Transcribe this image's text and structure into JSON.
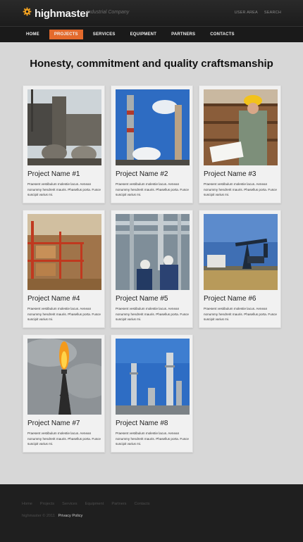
{
  "header": {
    "logo_text": "highmaster",
    "tagline": "Industrial Company",
    "top_links": [
      "USER AREA",
      "SEARCH"
    ],
    "nav": [
      "HOME",
      "PROJECTS",
      "SERVICES",
      "EQUIPMENT",
      "PARTNERS",
      "CONTACTS"
    ],
    "active_nav": "PROJECTS"
  },
  "main": {
    "heading": "Honesty, commitment and quality craftsmanship",
    "projects": [
      {
        "title": "Project Name #1",
        "desc": "Praesent vestibulum molestie lacus. Aenean nonummy hendrerit mauris. Phasellus porta. Fusce suscipit varius mi."
      },
      {
        "title": "Project Name #2",
        "desc": "Praesent vestibulum molestie lacus. Aenean nonummy hendrerit mauris. Phasellus porta. Fusce suscipit varius mi."
      },
      {
        "title": "Project Name #3",
        "desc": "Praesent vestibulum molestie lacus. Aenean nonummy hendrerit mauris. Phasellus porta. Fusce suscipit varius mi."
      },
      {
        "title": "Project Name #4",
        "desc": "Praesent vestibulum molestie lacus. Aenean nonummy hendrerit mauris. Phasellus porta. Fusce suscipit varius mi."
      },
      {
        "title": "Project Name #5",
        "desc": "Praesent vestibulum molestie lacus. Aenean nonummy hendrerit mauris. Phasellus porta. Fusce suscipit varius mi."
      },
      {
        "title": "Project Name #6",
        "desc": "Praesent vestibulum molestie lacus. Aenean nonummy hendrerit mauris. Phasellus porta. Fusce suscipit varius mi."
      },
      {
        "title": "Project Name #7",
        "desc": "Praesent vestibulum molestie lacus. Aenean nonummy hendrerit mauris. Phasellus porta. Fusce suscipit varius mi."
      },
      {
        "title": "Project Name #8",
        "desc": "Praesent vestibulum molestie lacus. Aenean nonummy hendrerit mauris. Phasellus porta. Fusce suscipit varius mi."
      }
    ]
  },
  "footer": {
    "links": [
      "Home",
      "Projects",
      "Services",
      "Equipment",
      "Partners",
      "Contacts"
    ],
    "copyright": "highmaster © 2011",
    "privacy": "Privacy Policy"
  },
  "colors": {
    "accent": "#e46a2c",
    "header_bg": "#1c1c1c",
    "page_bg": "#d7d7d7",
    "footer_bg": "#1f1f1f"
  },
  "icons": {
    "logo": "gear-icon"
  }
}
